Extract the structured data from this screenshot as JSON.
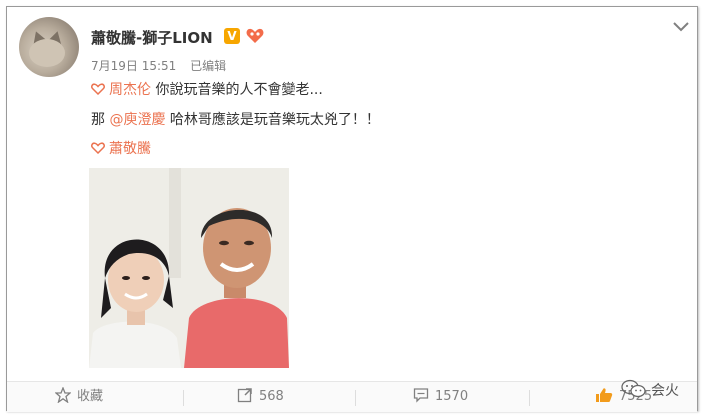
{
  "post": {
    "username": "蕭敬騰-獅子LION",
    "verified_badge": "V",
    "date": "7月19日 15:51",
    "edited": "已编辑",
    "line1_mention": "周杰伦",
    "line1_text": "你說玩音樂的人不會變老...",
    "line2_prefix": "那",
    "line2_mention": "@庾澄慶",
    "line2_text": "哈林哥應該是玩音樂玩太兇了！！",
    "line3_mention": "蕭敬騰"
  },
  "footer": {
    "favorite_label": "收藏",
    "repost_count": "568",
    "comment_count": "1570",
    "like_count": "7525"
  },
  "watermark": {
    "text": "会火"
  },
  "colors": {
    "mention": "#eb7350",
    "verified": "#f7a600",
    "meta": "#808080"
  },
  "icons": [
    "chevron-down-icon",
    "heart-link-icon",
    "star-icon",
    "repost-icon",
    "comment-icon",
    "like-icon",
    "wechat-icon"
  ]
}
